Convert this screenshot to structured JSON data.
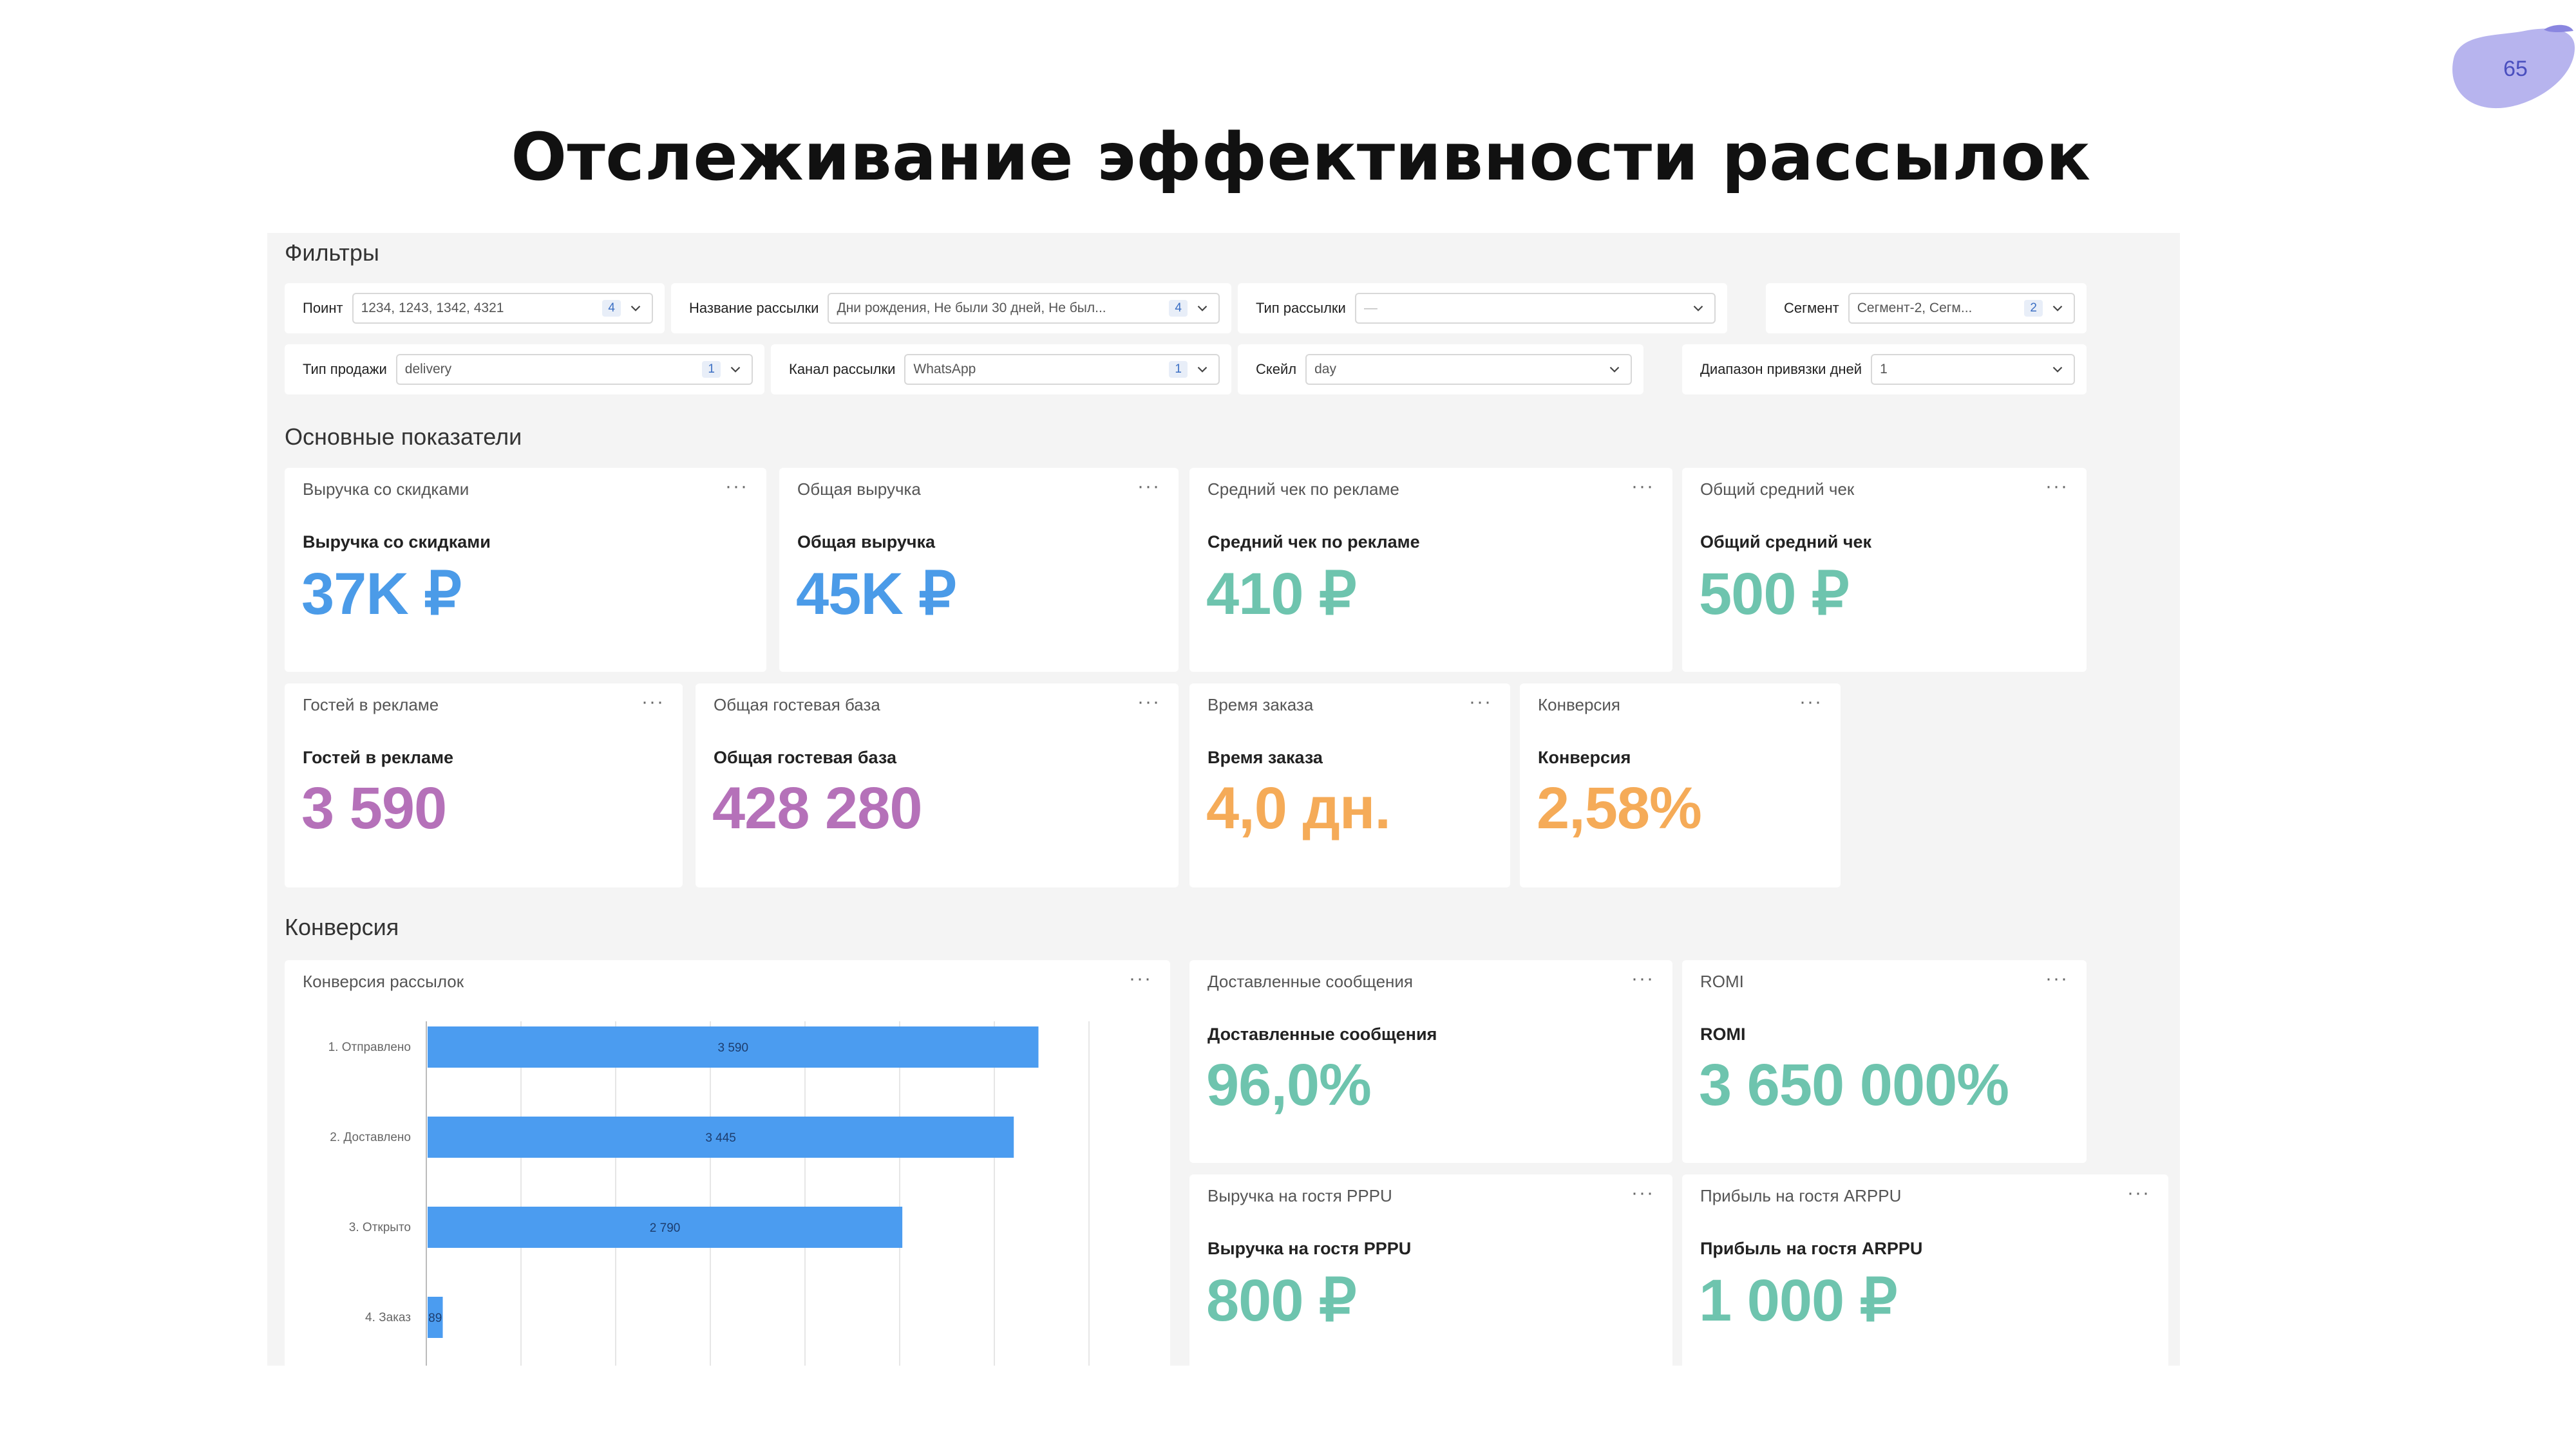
{
  "slide": {
    "page_number": "65",
    "title": "Отслеживание эффективности рассылок"
  },
  "colors": {
    "blue": "#4b9be8",
    "teal": "#6ec4ae",
    "purple": "#b571b9",
    "orange": "#f5ab58",
    "bar": "#4b9cf0",
    "blob": "#b7b4ee"
  },
  "sections": {
    "filters": "Фильтры",
    "kpi": "Основные показатели",
    "conversion": "Конверсия"
  },
  "filters": [
    {
      "label": "Поинт",
      "value": "1234, 1243, 1342, 4321",
      "count": "4"
    },
    {
      "label": "Название рассылки",
      "value": "Дни рождения, Не были 30 дней, Не был...",
      "count": "4"
    },
    {
      "label": "Тип рассылки",
      "value": "—",
      "count": ""
    },
    {
      "label": "Сегмент",
      "value": "Сегмент-2, Сегм...",
      "count": "2"
    },
    {
      "label": "Тип продажи",
      "value": "delivery",
      "count": "1"
    },
    {
      "label": "Канал рассылки",
      "value": "WhatsApp",
      "count": "1"
    },
    {
      "label": "Скейл",
      "value": "day",
      "count": ""
    },
    {
      "label": "Диапазон привязки дней",
      "value": "1",
      "count": ""
    }
  ],
  "kpi_row1": [
    {
      "header": "Выручка со скидками",
      "label": "Выручка со скидками",
      "value": "37K ₽",
      "color": "#4b9be8"
    },
    {
      "header": "Общая выручка",
      "label": "Общая выручка",
      "value": "45K ₽",
      "color": "#4b9be8"
    },
    {
      "header": "Средний чек по рекламе",
      "label": "Средний чек по рекламе",
      "value": "410 ₽",
      "color": "#6ec4ae"
    },
    {
      "header": "Общий средний чек",
      "label": "Общий средний чек",
      "value": "500 ₽",
      "color": "#6ec4ae"
    }
  ],
  "kpi_row2": [
    {
      "header": "Гостей в рекламе",
      "label": "Гостей в рекламе",
      "value": "3 590",
      "color": "#b571b9"
    },
    {
      "header": "Общая гостевая база",
      "label": "Общая гостевая база",
      "value": "428 280",
      "color": "#b571b9"
    },
    {
      "header": "Время заказа",
      "label": "Время заказа",
      "value": "4,0 дн.",
      "color": "#f5ab58"
    },
    {
      "header": "Конверсия",
      "label": "Конверсия",
      "value": "2,58%",
      "color": "#f5ab58"
    }
  ],
  "conv_cards": [
    {
      "header": "Доставленные сообщения",
      "label": "Доставленные сообщения",
      "value": "96,0%",
      "color": "#6ec4ae"
    },
    {
      "header": "ROMI",
      "label": "ROMI",
      "value": "3 650 000%",
      "color": "#6ec4ae"
    },
    {
      "header": "Выручка на гостя PPPU",
      "label": "Выручка на гостя PPPU",
      "value": "800 ₽",
      "color": "#6ec4ae"
    },
    {
      "header": "Прибыль на гостя ARPPU",
      "label": "Прибыль на гостя ARPPU",
      "value": "1 000 ₽",
      "color": "#6ec4ae"
    }
  ],
  "menu_glyph": "···",
  "chart_data": {
    "type": "bar",
    "orientation": "horizontal",
    "title": "Конверсия рассылок",
    "categories": [
      "1. Отправлено",
      "2. Доставлено",
      "3. Открыто",
      "4. Заказ"
    ],
    "values": [
      3590,
      3445,
      2790,
      89
    ],
    "value_labels": [
      "3 590",
      "3 445",
      "2 790",
      "89"
    ],
    "xlim": [
      0,
      4000
    ],
    "grid": true,
    "color": "#4b9cf0"
  }
}
